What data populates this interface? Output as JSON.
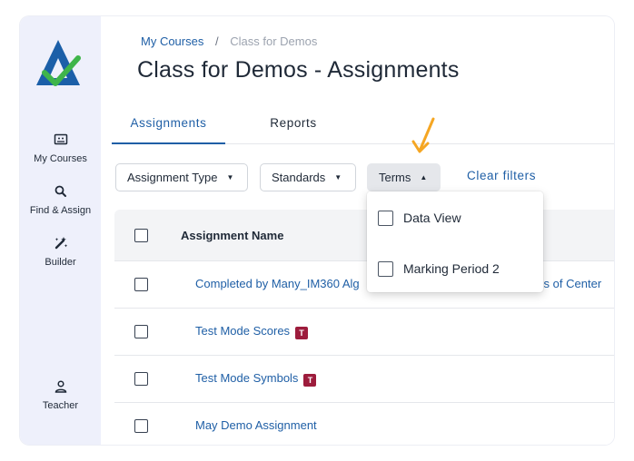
{
  "sidebar": {
    "items": [
      {
        "label": "My Courses",
        "icon": "course-card-icon"
      },
      {
        "label": "Find & Assign",
        "icon": "search-icon"
      },
      {
        "label": "Builder",
        "icon": "magic-wand-icon"
      },
      {
        "label": "Teacher",
        "icon": "user-icon"
      }
    ]
  },
  "breadcrumb": {
    "link": "My Courses",
    "separator": "/",
    "current": "Class for Demos"
  },
  "page_title": "Class for Demos - Assignments",
  "tabs": [
    {
      "label": "Assignments",
      "active": true
    },
    {
      "label": "Reports",
      "active": false
    }
  ],
  "filters": {
    "assignment_type": "Assignment Type",
    "standards": "Standards",
    "terms": "Terms",
    "clear": "Clear filters"
  },
  "terms_dropdown": {
    "options": [
      "Data View",
      "Marking Period 2"
    ]
  },
  "table": {
    "header": "Assignment Name",
    "rows": [
      {
        "name": "Completed by Many_IM360 Alg",
        "tail": "res of Center",
        "badge": ""
      },
      {
        "name": "Test Mode Scores",
        "tail": "",
        "badge": "T"
      },
      {
        "name": "Test Mode Symbols",
        "tail": "",
        "badge": "T"
      },
      {
        "name": "May Demo Assignment",
        "tail": "",
        "badge": ""
      }
    ]
  },
  "colors": {
    "accent": "#1f5fa6",
    "sidebar_bg": "#eef0fb",
    "badge": "#9d1c3c",
    "arrow": "#f5a623",
    "logo_blue": "#1b5fa8",
    "logo_check": "#3fb54a"
  }
}
